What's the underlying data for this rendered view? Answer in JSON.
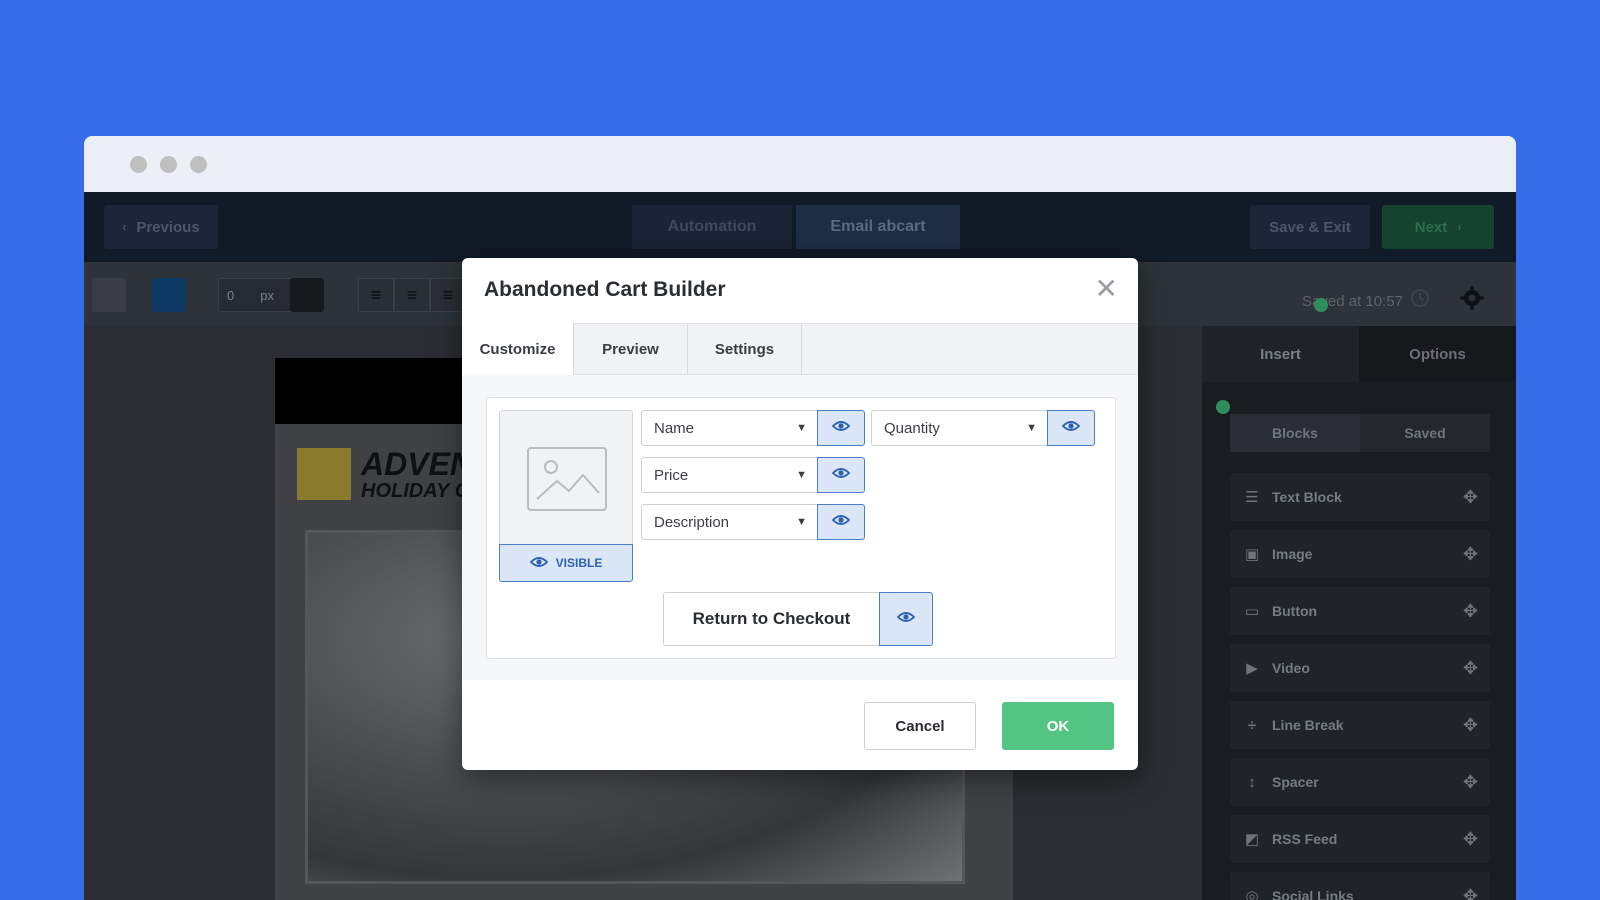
{
  "colors": {
    "background": "#356ce8",
    "accent_green": "#52c483",
    "eye_blue": "#2d61b3",
    "dark_topbar": "#111a27"
  },
  "topbar": {
    "previous_label": "Previous",
    "crumbs": [
      "Automation",
      "Email abcart"
    ],
    "save_exit_label": "Save & Exit",
    "next_label": "Next"
  },
  "toolbar": {
    "num_value": "0",
    "num_unit": "px",
    "saved_text": "Saved at 10:57"
  },
  "email": {
    "brand": "ADVEN",
    "brand_sub": "HOLIDAY C"
  },
  "right_panel": {
    "tabs": [
      "Insert",
      "Options"
    ],
    "subtabs": [
      "Blocks",
      "Saved"
    ],
    "blocks": [
      {
        "label": "Text Block",
        "icon": "text-lines-icon"
      },
      {
        "label": "Image",
        "icon": "image-icon"
      },
      {
        "label": "Button",
        "icon": "button-icon"
      },
      {
        "label": "Video",
        "icon": "play-icon"
      },
      {
        "label": "Line Break",
        "icon": "line-break-icon"
      },
      {
        "label": "Spacer",
        "icon": "spacer-icon"
      },
      {
        "label": "RSS Feed",
        "icon": "rss-icon"
      },
      {
        "label": "Social Links",
        "icon": "social-icon"
      }
    ]
  },
  "modal": {
    "title": "Abandoned Cart Builder",
    "tabs": [
      "Customize",
      "Preview",
      "Settings"
    ],
    "active_tab": "Customize",
    "image_visible_label": "VISIBLE",
    "fields": {
      "name": "Name",
      "quantity": "Quantity",
      "price": "Price",
      "description": "Description"
    },
    "return_label": "Return to Checkout",
    "cancel_label": "Cancel",
    "ok_label": "OK"
  }
}
